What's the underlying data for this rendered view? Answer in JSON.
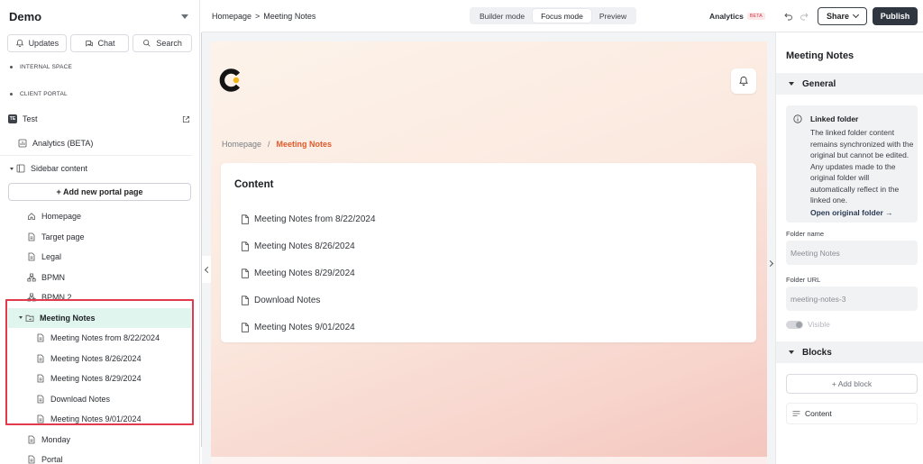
{
  "workspace": {
    "title": "Demo"
  },
  "quick_actions": [
    {
      "label": "Updates",
      "icon": "bell-icon"
    },
    {
      "label": "Chat",
      "icon": "chat-icon"
    },
    {
      "label": "Search",
      "icon": "search-icon"
    }
  ],
  "sidebar": {
    "sections": {
      "internal": "INTERNAL SPACE",
      "client": "CLIENT PORTAL"
    },
    "portal": {
      "badge": "TE",
      "name": "Test"
    },
    "analytics": "Analytics (BETA)",
    "sidebar_content": "Sidebar content",
    "add_page": "+ Add new portal page",
    "pages": {
      "homepage": "Homepage",
      "target": "Target page",
      "legal": "Legal",
      "bpmn": "BPMN",
      "bpmn2": "BPMN 2",
      "folder": "Meeting Notes",
      "children": [
        "Meeting Notes from 8/22/2024",
        "Meeting Notes 8/26/2024",
        "Meeting Notes 8/29/2024",
        "Download Notes",
        "Meeting Notes 9/01/2024"
      ],
      "monday": "Monday",
      "portal": "Portal"
    }
  },
  "topbar": {
    "breadcrumb": [
      "Homepage",
      ">",
      "Meeting Notes"
    ],
    "modes": [
      "Builder mode",
      "Focus mode",
      "Preview"
    ],
    "analytics": "Analytics",
    "beta": "BETA",
    "share": "Share",
    "publish": "Publish"
  },
  "preview": {
    "breadcrumb": {
      "home": "Homepage",
      "sep": "/",
      "current": "Meeting Notes"
    },
    "card_title": "Content",
    "items": [
      "Meeting Notes from 8/22/2024",
      "Meeting Notes 8/26/2024",
      "Meeting Notes 8/29/2024",
      "Download Notes",
      "Meeting Notes 9/01/2024"
    ]
  },
  "panel": {
    "title": "Meeting Notes",
    "general": "General",
    "info_title": "Linked folder",
    "info_text": "The linked folder content remains synchronized with the original but cannot be edited. Any updates made to the original folder will automatically reflect in the linked one.",
    "info_link": "Open original folder →",
    "folder_name_label": "Folder name",
    "folder_name_value": "Meeting Notes",
    "folder_url_label": "Folder URL",
    "folder_url_value": "meeting-notes-3",
    "visible_label": "Visible",
    "blocks": "Blocks",
    "add_block": "+ Add block",
    "block_item": "Content"
  },
  "colors": {
    "accent_orange": "#e0592a",
    "highlight_red": "#e03a4c",
    "active_folder_bg": "#dff5ee",
    "publish_bg": "#2f3640"
  }
}
